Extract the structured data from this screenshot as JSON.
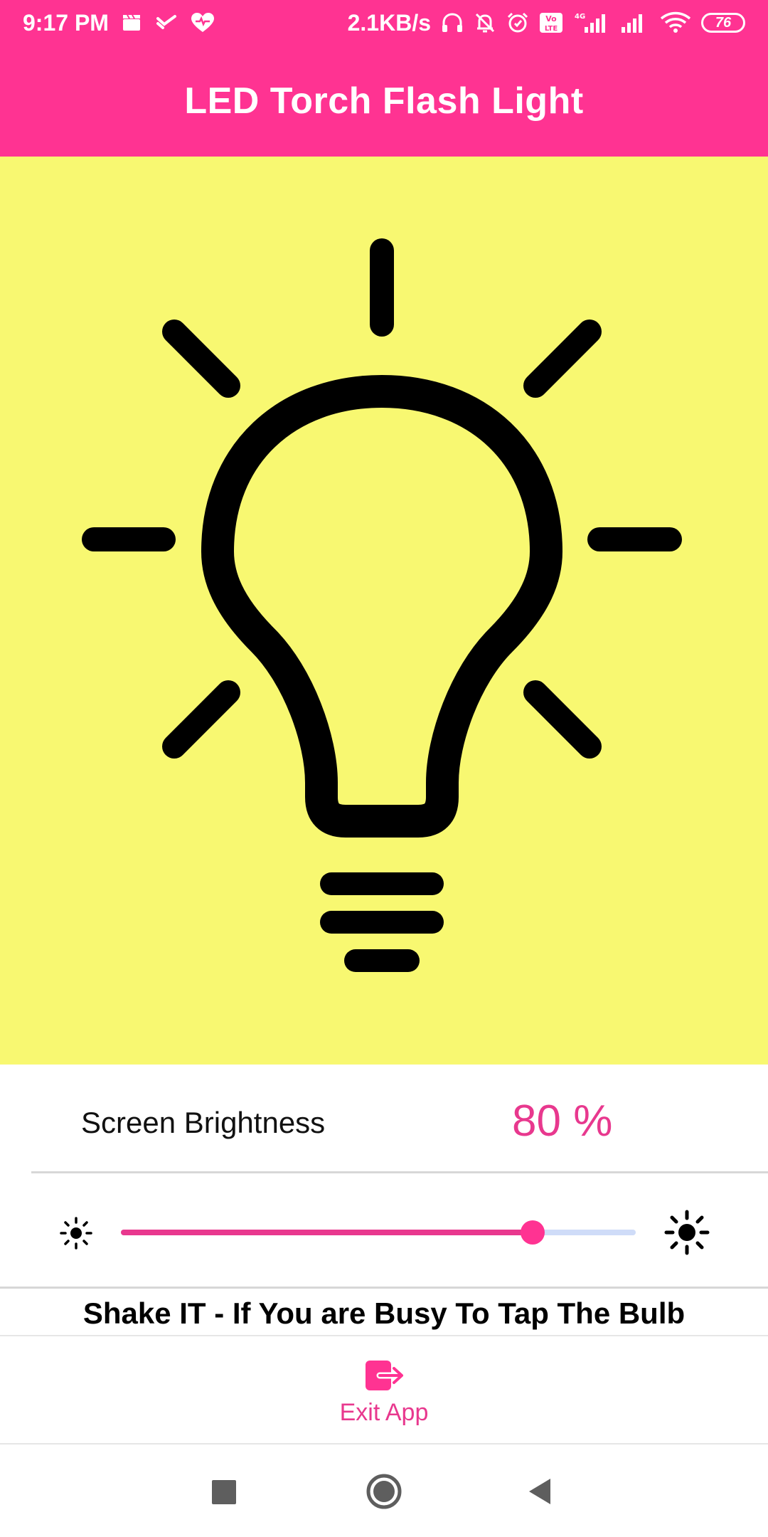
{
  "status_bar": {
    "time": "9:17 PM",
    "network_speed": "2.1KB/s",
    "network_type": "4G",
    "volte": "Vo LTE",
    "battery_level": "76",
    "left_icons": [
      "clapperboard-icon",
      "check-mail-icon",
      "heart-health-icon"
    ],
    "right_icons": [
      "headphones-icon",
      "bell-off-icon",
      "alarm-icon",
      "volte-icon",
      "signal-4g-icon",
      "signal-icon",
      "wifi-icon",
      "battery-icon"
    ]
  },
  "header": {
    "title": "LED Torch Flash Light",
    "background_color": "#ff3392"
  },
  "bulb": {
    "icon": "lightbulb-icon",
    "background_color": "#f8f871",
    "stroke_color": "#000000"
  },
  "brightness": {
    "label": "Screen Brightness",
    "value_text": "80 %",
    "value": 80,
    "accent_color": "#e8388e",
    "min_icon": "sun-small-icon",
    "max_icon": "sun-large-icon"
  },
  "shake_hint": "Shake IT - If You are Busy To Tap The Bulb",
  "exit": {
    "label": "Exit App",
    "icon": "exit-icon"
  },
  "nav_bar": {
    "icons": [
      "recents-icon",
      "home-icon",
      "back-icon"
    ]
  }
}
